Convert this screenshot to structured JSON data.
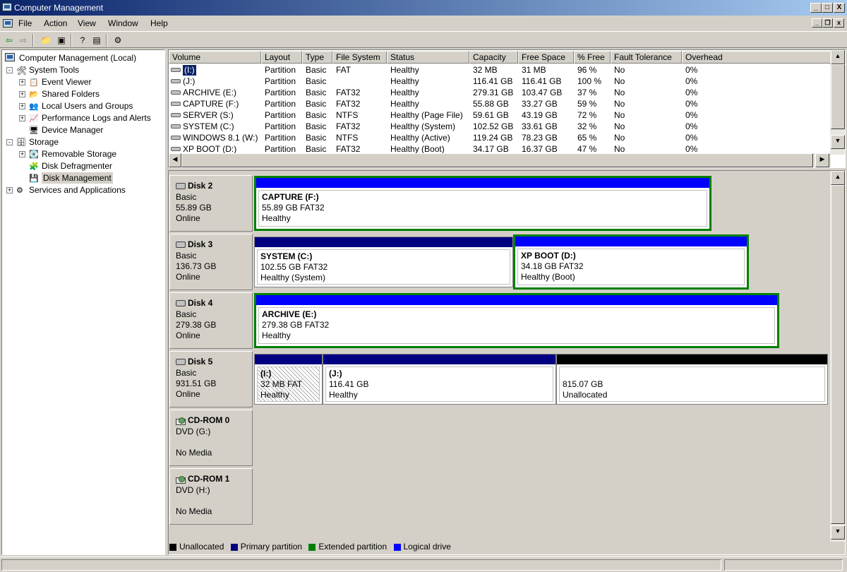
{
  "window": {
    "title": "Computer Management",
    "min": "_",
    "max": "□",
    "close": "X"
  },
  "menu": {
    "items": [
      "File",
      "Action",
      "View",
      "Window",
      "Help"
    ]
  },
  "tree": {
    "root": "Computer Management (Local)",
    "system_tools": "System Tools",
    "event_viewer": "Event Viewer",
    "shared_folders": "Shared Folders",
    "local_users": "Local Users and Groups",
    "perf_logs": "Performance Logs and Alerts",
    "device_manager": "Device Manager",
    "storage": "Storage",
    "removable_storage": "Removable Storage",
    "disk_defrag": "Disk Defragmenter",
    "disk_mgmt": "Disk Management",
    "services_apps": "Services and Applications"
  },
  "volumes": {
    "columns": [
      "Volume",
      "Layout",
      "Type",
      "File System",
      "Status",
      "Capacity",
      "Free Space",
      "% Free",
      "Fault Tolerance",
      "Overhead"
    ],
    "rows": [
      [
        "(I:)",
        "Partition",
        "Basic",
        "FAT",
        "Healthy",
        "32 MB",
        "31 MB",
        "96 %",
        "No",
        "0%"
      ],
      [
        "(J:)",
        "Partition",
        "Basic",
        "",
        "Healthy",
        "116.41 GB",
        "116.41 GB",
        "100 %",
        "No",
        "0%"
      ],
      [
        "ARCHIVE (E:)",
        "Partition",
        "Basic",
        "FAT32",
        "Healthy",
        "279.31 GB",
        "103.47 GB",
        "37 %",
        "No",
        "0%"
      ],
      [
        "CAPTURE (F:)",
        "Partition",
        "Basic",
        "FAT32",
        "Healthy",
        "55.88 GB",
        "33.27 GB",
        "59 %",
        "No",
        "0%"
      ],
      [
        "SERVER (S:)",
        "Partition",
        "Basic",
        "NTFS",
        "Healthy (Page File)",
        "59.61 GB",
        "43.19 GB",
        "72 %",
        "No",
        "0%"
      ],
      [
        "SYSTEM (C:)",
        "Partition",
        "Basic",
        "FAT32",
        "Healthy (System)",
        "102.52 GB",
        "33.61 GB",
        "32 %",
        "No",
        "0%"
      ],
      [
        "WINDOWS 8.1 (W:)",
        "Partition",
        "Basic",
        "NTFS",
        "Healthy (Active)",
        "119.24 GB",
        "78.23 GB",
        "65 %",
        "No",
        "0%"
      ],
      [
        "XP BOOT (D:)",
        "Partition",
        "Basic",
        "FAT32",
        "Healthy (Boot)",
        "34.17 GB",
        "16.37 GB",
        "47 %",
        "No",
        "0%"
      ]
    ]
  },
  "disks": [
    {
      "name": "Disk 2",
      "type": "Basic",
      "size": "55.89 GB",
      "state": "Online"
    },
    {
      "name": "Disk 3",
      "type": "Basic",
      "size": "136.73 GB",
      "state": "Online"
    },
    {
      "name": "Disk 4",
      "type": "Basic",
      "size": "279.38 GB",
      "state": "Online"
    },
    {
      "name": "Disk 5",
      "type": "Basic",
      "size": "931.51 GB",
      "state": "Online"
    },
    {
      "name": "CD-ROM 0",
      "type": "DVD (G:)",
      "state": "No Media"
    },
    {
      "name": "CD-ROM 1",
      "type": "DVD (H:)",
      "state": "No Media"
    }
  ],
  "partitions": {
    "capture": {
      "name": "CAPTURE  (F:)",
      "size": "55.89 GB FAT32",
      "status": "Healthy"
    },
    "system": {
      "name": "SYSTEM  (C:)",
      "size": "102.55 GB FAT32",
      "status": "Healthy (System)"
    },
    "xpboot": {
      "name": "XP BOOT  (D:)",
      "size": "34.18 GB FAT32",
      "status": "Healthy (Boot)"
    },
    "archive": {
      "name": "ARCHIVE  (E:)",
      "size": "279.38 GB FAT32",
      "status": "Healthy"
    },
    "i": {
      "name": "(I:)",
      "size": "32 MB FAT",
      "status": "Healthy"
    },
    "j": {
      "name": "(J:)",
      "size": "116.41 GB",
      "status": "Healthy"
    },
    "unalloc": {
      "size": "815.07 GB",
      "status": "Unallocated"
    }
  },
  "legend": {
    "unallocated": "Unallocated",
    "primary": "Primary partition",
    "extended": "Extended partition",
    "logical": "Logical drive"
  },
  "colors": {
    "primary": "#000080",
    "extended": "#008000",
    "logical": "#0000ff",
    "unallocated": "#000000",
    "title_start": "#0a246a"
  }
}
